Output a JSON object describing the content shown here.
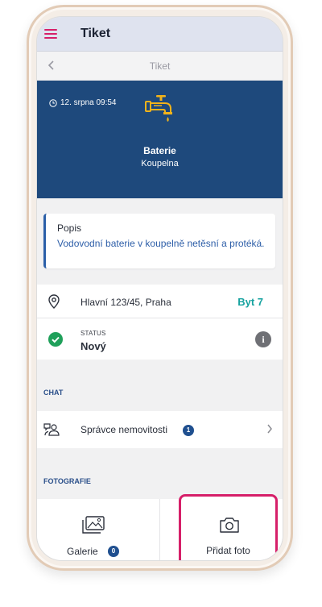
{
  "app_bar": {
    "title": "Tiket"
  },
  "nav": {
    "title": "Tiket"
  },
  "hero": {
    "time": "12. srpna 09:54",
    "title": "Baterie",
    "subtitle": "Koupelna",
    "accent_color": "#f2b31a",
    "bg_color": "#1e497c"
  },
  "description": {
    "label": "Popis",
    "text": "Vodovodní baterie v koupelně netěsní a protéká."
  },
  "address": {
    "text": "Hlavní 123/45, Praha",
    "flat": "Byt 7"
  },
  "status": {
    "label": "STATUS",
    "value": "Nový"
  },
  "chat": {
    "section_title": "CHAT",
    "item_label": "Správce nemovitosti",
    "badge": "1"
  },
  "photos": {
    "section_title": "FOTOGRAFIE",
    "gallery_label": "Galerie",
    "gallery_badge": "0",
    "add_label": "Přidat foto",
    "highlight_color": "#d61f69"
  },
  "icons": [
    "menu-icon",
    "back-icon",
    "clock-icon",
    "faucet-icon",
    "location-pin-icon",
    "check-circle-icon",
    "info-icon",
    "people-icon",
    "chevron-right-icon",
    "gallery-icon",
    "camera-icon"
  ]
}
